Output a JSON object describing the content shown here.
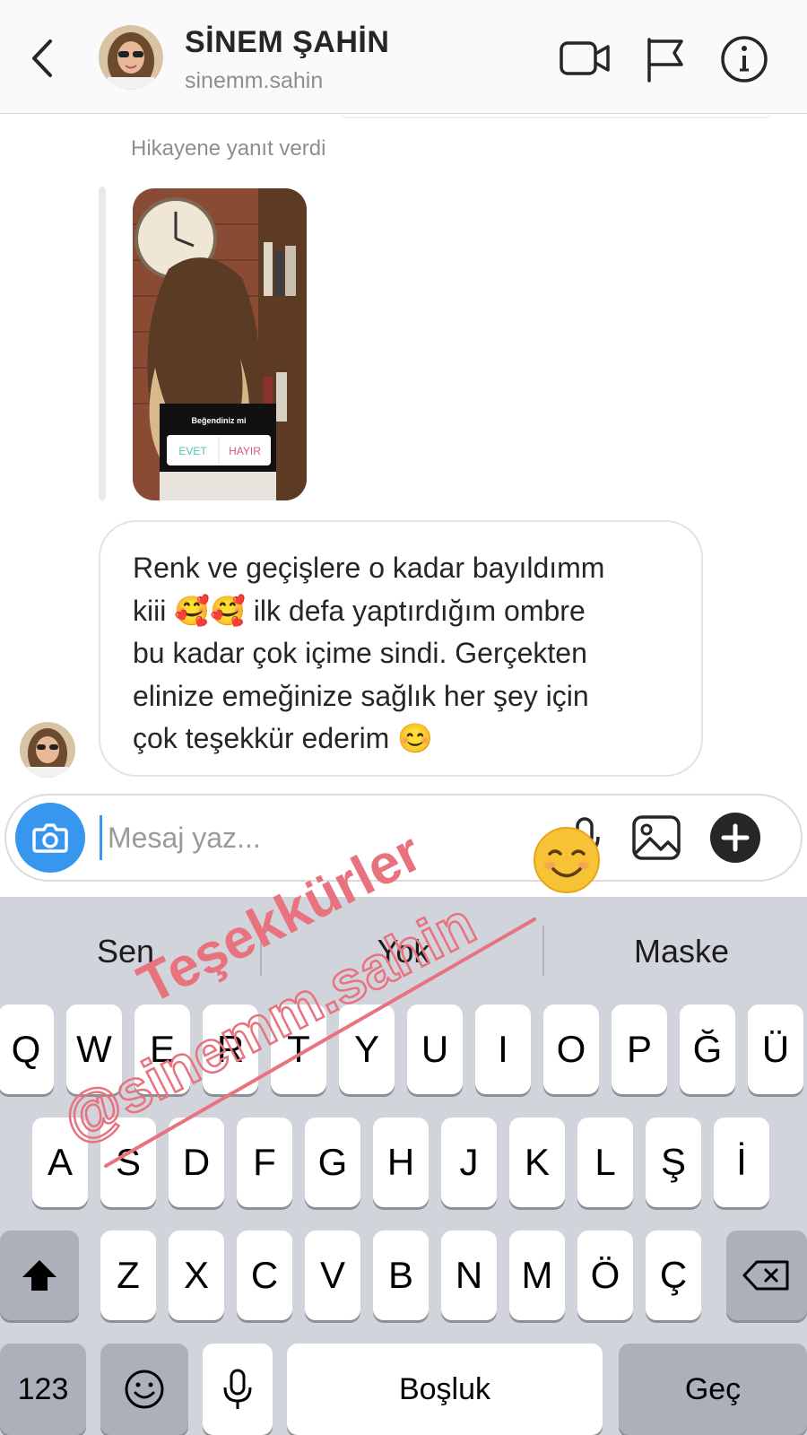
{
  "header": {
    "name": "SİNEM ŞAHİN",
    "username": "sinemm.sahin",
    "icons": [
      "back-chevron-icon",
      "video-call-icon",
      "flag-icon",
      "info-icon"
    ]
  },
  "chat": {
    "story_reply_label": "Hikayene yanıt verdi",
    "story_sticker": {
      "question": "Beğendiniz mi",
      "yes": "EVET",
      "no": "HAYIR"
    },
    "message": "Renk ve geçişlere o kadar bayıldımm\nkiii 🥰🥰 ilk defa yaptırdığım ombre\nbu kadar çok içime sindi. Gerçekten\nelinize emeğinize sağlık her şey için\nçok teşekkür ederim 😊"
  },
  "composer": {
    "placeholder": "Mesaj yaz...",
    "icons": [
      "camera-icon",
      "microphone-icon",
      "gallery-icon",
      "plus-icon"
    ]
  },
  "keyboard": {
    "suggestions": [
      "Sen",
      "Yok",
      "Maske"
    ],
    "row1": [
      "Q",
      "W",
      "E",
      "R",
      "T",
      "Y",
      "U",
      "I",
      "O",
      "P",
      "Ğ",
      "Ü"
    ],
    "row2": [
      "A",
      "S",
      "D",
      "F",
      "G",
      "H",
      "J",
      "K",
      "L",
      "Ş",
      "İ"
    ],
    "row3": [
      "Z",
      "X",
      "C",
      "V",
      "B",
      "N",
      "M",
      "Ö",
      "Ç"
    ],
    "numbers_key": "123",
    "space_key": "Boşluk",
    "return_key": "Geç"
  },
  "watermark": {
    "line1": "Teşekkürler",
    "line2": "@sinemm.sahin",
    "color": "#e8737f"
  }
}
